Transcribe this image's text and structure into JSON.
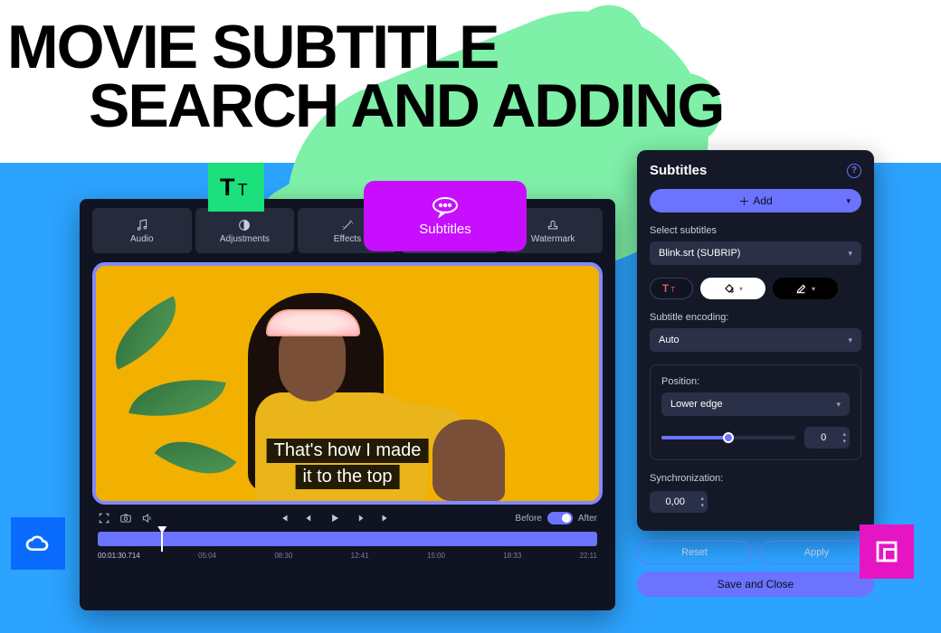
{
  "headline": {
    "line1": "MOVIE SUBTITLE",
    "line2": "SEARCH AND ADDING"
  },
  "tabs": {
    "audio": "Audio",
    "adjustments": "Adjustments",
    "effects": "Effects",
    "subtitles": "Subtitles",
    "watermark": "Watermark"
  },
  "badge": {
    "subtitles": "Subtitles"
  },
  "subtitle_overlay": {
    "line1": "That's how I made",
    "line2": "it to the top"
  },
  "transport": {
    "before": "Before",
    "after": "After"
  },
  "timeline": {
    "current": "00:01:30.714",
    "t1": "05:04",
    "t2": "08:30",
    "t3": "12:41",
    "t4": "15:00",
    "t5": "18:33",
    "t6": "22:11"
  },
  "panel": {
    "title": "Subtitles",
    "add": "Add",
    "select_label": "Select subtitles",
    "file": "Blink.srt (SUBRIP)",
    "encoding_label": "Subtitle encoding:",
    "encoding": "Auto",
    "position_label": "Position:",
    "position": "Lower edge",
    "position_offset": "0",
    "sync_label": "Synchronization:",
    "sync": "0,00"
  },
  "buttons": {
    "reset": "Reset",
    "apply": "Apply",
    "save": "Save and Close"
  }
}
